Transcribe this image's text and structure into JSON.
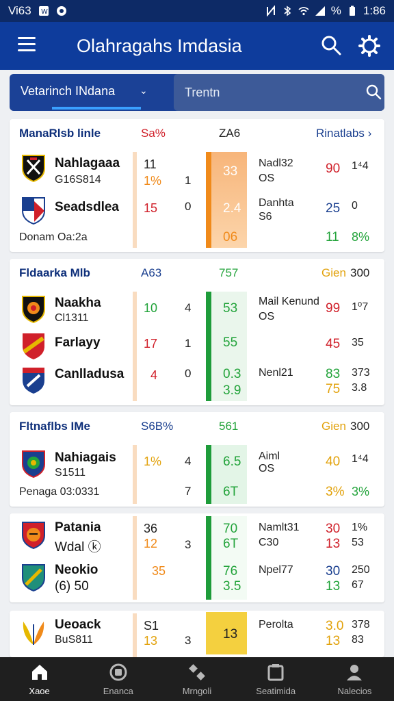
{
  "status": {
    "left_text": "Vi63",
    "time": "1:86",
    "battery": "%"
  },
  "appbar": {
    "title": "Olahragahs Imdasia"
  },
  "search": {
    "filter_label": "Vetarinch INdana",
    "placeholder": "Trentn"
  },
  "cards": [
    {
      "league": "ManaRlsb linle",
      "col1": "Sa%",
      "col2": "ZA6",
      "link": "Rinatlabs ›",
      "rows": [
        {
          "crest": "shield-star-icon",
          "name": "Nahlagaaa",
          "sub": "G16S814",
          "c1": "11",
          "c1b": "1%",
          "c2": "1",
          "mid": "33",
          "info1": "Nadl32",
          "info2": "OS",
          "r1": "90",
          "r2": "1⁴4"
        },
        {
          "crest": "shield-flag-icon",
          "name": "Seadsdlea",
          "sub": "",
          "c1": "15",
          "c1b": "",
          "c2": "0",
          "mid": "2.4",
          "mid2": "06",
          "info1": "Danhta",
          "info2": "S6",
          "r1": "25",
          "r2": "0",
          "r1b": "11",
          "r2b": "8%"
        }
      ],
      "footnote": "Donam Oa:2a"
    },
    {
      "league": "Fldaarka Mlb",
      "col1": "A63",
      "col2": "757",
      "link": "Gien",
      "link2": "300",
      "rows": [
        {
          "crest": "shield-lion-icon",
          "name": "Naakha",
          "sub": "Cl1311",
          "c1": "10",
          "c2": "4",
          "mid": "53",
          "info1": "Mail Kenund",
          "info2": "OS",
          "r1": "99",
          "r2": "1⁰7"
        },
        {
          "crest": "shield-stripe-icon",
          "name": "Farlayy",
          "sub": "",
          "c1": "17",
          "c2": "1",
          "mid": "55",
          "info1": "",
          "info2": "",
          "r1": "45",
          "r2": "35"
        },
        {
          "crest": "shield-badge-icon",
          "name": "Canlladusa",
          "sub": "",
          "c1": "4",
          "c2": "0",
          "mid": "0.3",
          "mid2": "3.9",
          "info1": "Nenl21",
          "info2": "",
          "r1": "83",
          "r2": "373",
          "r1b": "75",
          "r2b": "3.8"
        }
      ]
    },
    {
      "league": "Fltnaflbs IMe",
      "col1": "S6B%",
      "col2": "561",
      "link": "Gien",
      "link2": "300",
      "rows": [
        {
          "crest": "shield-ball-icon",
          "name": "Nahiagais",
          "sub": "S1511",
          "c1": "1%",
          "c2": "4",
          "c2b": "7",
          "mid": "6.5",
          "mid2": "6T",
          "info1": "Aiml",
          "info2": "OS",
          "r1": "40",
          "r2": "1⁴4",
          "r1b": "3%",
          "r2b": "3%"
        }
      ],
      "footnote": "Penaga 03:0331"
    },
    {
      "rows": [
        {
          "crest": "shield-tiger-icon",
          "name": "Patania",
          "sub": "Wdal ⓚ",
          "c1": "36",
          "c1b": "12",
          "c2": "3",
          "mid": "70",
          "mid2": "6T",
          "info1": "Namlt31",
          "info2": "C30",
          "r1": "30",
          "r2": "1%",
          "r1b": "13",
          "r2b": "53"
        },
        {
          "crest": "shield-leaf-icon",
          "name": "Neokio",
          "sub": "(6) 50",
          "c1": "35",
          "c2": "",
          "mid": "76",
          "mid2": "3.5",
          "info1": "Npel77",
          "info2": "",
          "r1": "30",
          "r2": "250",
          "r1b": "13",
          "r2b": "67"
        }
      ]
    },
    {
      "rows": [
        {
          "crest": "wing-icon",
          "name": "Ueoack",
          "sub": "BuS811",
          "c1": "S1",
          "c1b": "13",
          "c2": "3",
          "mid": "13",
          "info1": "Perolta",
          "info2": "",
          "r1": "3.0",
          "r2": "378",
          "r1b": "13",
          "r2b": "83"
        }
      ]
    }
  ],
  "nav": [
    {
      "icon": "home-icon",
      "label": "Xaoe"
    },
    {
      "icon": "sports-icon",
      "label": "Enanca"
    },
    {
      "icon": "match-icon",
      "label": "Mrngoli"
    },
    {
      "icon": "stats-icon",
      "label": "Seatimida"
    },
    {
      "icon": "profile-icon",
      "label": "Nalecios"
    }
  ],
  "colors": {
    "primary": "#0e3c9c",
    "accent": "#3aa0ff",
    "red": "#d0202a",
    "orange": "#f08a1a",
    "green": "#22a33a",
    "yellow": "#e2a20c"
  }
}
